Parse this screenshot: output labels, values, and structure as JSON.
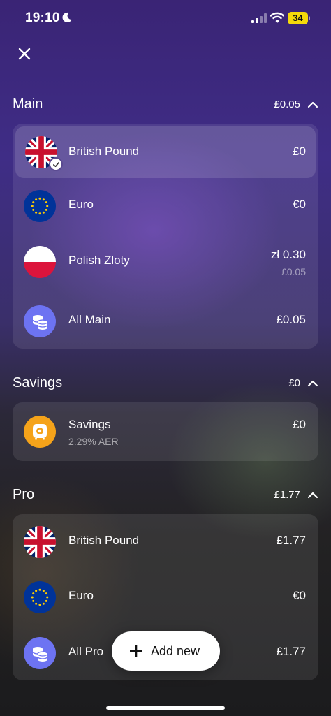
{
  "status_bar": {
    "time": "19:10",
    "battery": "34"
  },
  "sections": {
    "main": {
      "title": "Main",
      "total": "£0.05",
      "rows": [
        {
          "label": "British Pound",
          "amount": "£0",
          "icon": "uk-flag-icon",
          "selected": true
        },
        {
          "label": "Euro",
          "amount": "€0",
          "icon": "eu-flag-icon"
        },
        {
          "label": "Polish Zloty",
          "amount": "zł 0.30",
          "subamount": "£0.05",
          "icon": "poland-flag-icon"
        },
        {
          "label": "All Main",
          "amount": "£0.05",
          "icon": "coins-icon"
        }
      ]
    },
    "savings": {
      "title": "Savings",
      "total": "£0",
      "rows": [
        {
          "label": "Savings",
          "sublabel": "2.29% AER",
          "amount": "£0",
          "icon": "safe-icon"
        }
      ]
    },
    "pro": {
      "title": "Pro",
      "total": "£1.77",
      "rows": [
        {
          "label": "British Pound",
          "amount": "£1.77",
          "icon": "uk-flag-icon"
        },
        {
          "label": "Euro",
          "amount": "€0",
          "icon": "eu-flag-icon"
        },
        {
          "label": "All Pro",
          "amount": "£1.77",
          "icon": "coins-icon"
        }
      ]
    }
  },
  "add_new": {
    "label": "Add new"
  },
  "colors": {
    "coins": "#6d73f2",
    "savings": "#f5a31a",
    "battery": "#f5d90a"
  }
}
